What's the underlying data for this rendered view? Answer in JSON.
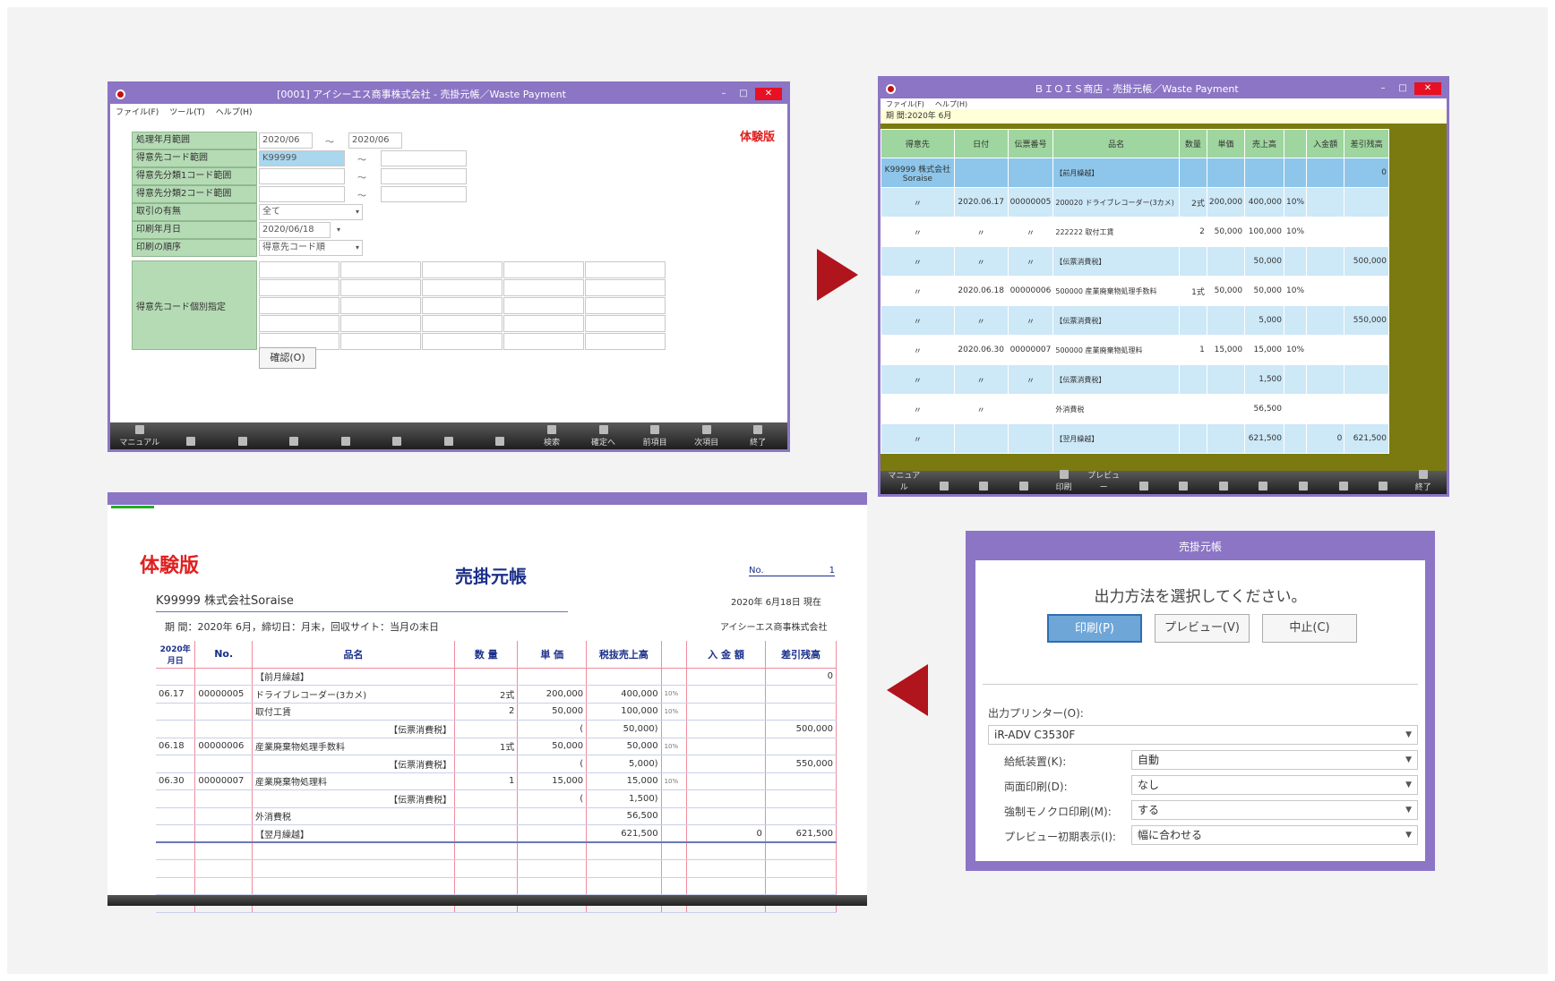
{
  "win1": {
    "title": "[0001] アイシーエス商事株式会社 - 売掛元帳／Waste Payment",
    "menu": [
      "ファイル(F)",
      "ツール(T)",
      "ヘルプ(H)"
    ],
    "trial": "体験版",
    "fields": [
      {
        "label": "処理年月範囲",
        "from": "2020/06",
        "to": "2020/06"
      },
      {
        "label": "得意先コード範囲",
        "from": "K99999",
        "to": ""
      },
      {
        "label": "得意先分類1コード範囲",
        "from": "",
        "to": ""
      },
      {
        "label": "得意先分類2コード範囲",
        "from": "",
        "to": ""
      }
    ],
    "tilde": "～",
    "torihiki_label": "取引の有無",
    "torihiki_value": "全て",
    "print_date_label": "印刷年月日",
    "print_date_value": "2020/06/18",
    "order_label": "印刷の順序",
    "order_value": "得意先コード順",
    "indiv_label": "得意先コード個別指定",
    "confirm": "確認(O)",
    "fkeys": [
      "マニュアル",
      "",
      "",
      "",
      "",
      "",
      "",
      "",
      "検索",
      "確定へ",
      "前項目",
      "次項目",
      "終了"
    ]
  },
  "win2": {
    "title": "ＢＩＯＩＳ商店 - 売掛元帳／Waste Payment",
    "menu": [
      "ファイル(F)",
      "ヘルプ(H)"
    ],
    "period": "期 間:2020年 6月",
    "headers": [
      "得意先",
      "日付",
      "伝票番号",
      "品名",
      "数量",
      "単価",
      "売上高",
      "",
      "入金額",
      "差引残高"
    ],
    "rows": [
      {
        "cls": "sel",
        "c": [
          "K99999 株式会社Soraise",
          "",
          "",
          "【前月繰越】",
          "",
          "",
          "",
          "",
          "",
          "0"
        ]
      },
      {
        "cls": "b",
        "c": [
          "〃",
          "2020.06.17",
          "00000005",
          "200020 ドライブレコーダー(3カメ)",
          "2式",
          "200,000",
          "400,000",
          "10%",
          "",
          ""
        ]
      },
      {
        "cls": "w",
        "c": [
          "〃",
          "〃",
          "〃",
          "222222 取付工賃",
          "2",
          "50,000",
          "100,000",
          "10%",
          "",
          ""
        ]
      },
      {
        "cls": "b",
        "c": [
          "〃",
          "〃",
          "〃",
          "【伝票消費税】",
          "",
          "",
          "50,000",
          "",
          "",
          "500,000"
        ]
      },
      {
        "cls": "w",
        "c": [
          "〃",
          "2020.06.18",
          "00000006",
          "500000 産業廃棄物処理手数料",
          "1式",
          "50,000",
          "50,000",
          "10%",
          "",
          ""
        ]
      },
      {
        "cls": "b",
        "c": [
          "〃",
          "〃",
          "〃",
          "【伝票消費税】",
          "",
          "",
          "5,000",
          "",
          "",
          "550,000"
        ]
      },
      {
        "cls": "w",
        "c": [
          "〃",
          "2020.06.30",
          "00000007",
          "500000 産業廃棄物処理料",
          "1",
          "15,000",
          "15,000",
          "10%",
          "",
          ""
        ]
      },
      {
        "cls": "b",
        "c": [
          "〃",
          "〃",
          "〃",
          "【伝票消費税】",
          "",
          "",
          "1,500",
          "",
          "",
          ""
        ]
      },
      {
        "cls": "w",
        "c": [
          "〃",
          "〃",
          "",
          "外消費税",
          "",
          "",
          "56,500",
          "",
          "",
          ""
        ]
      },
      {
        "cls": "b",
        "c": [
          "〃",
          "",
          "",
          "【翌月繰越】",
          "",
          "",
          "621,500",
          "",
          "0",
          "621,500"
        ]
      }
    ],
    "fkeys": [
      "マニュアル",
      "",
      "",
      "",
      "印刷",
      "プレビュー",
      "",
      "",
      "",
      "",
      "",
      "",
      "",
      "終了"
    ]
  },
  "preview": {
    "trial": "体験版",
    "title": "売掛元帳",
    "no_label": "No.",
    "no_value": "1",
    "customer": "K99999 株式会社Soraise",
    "date": "2020年 6月18日 現在",
    "conditions": "期 間：2020年 6月，締切日：月末，回収サイト：当月の末日",
    "company": "アイシーエス商事株式会社",
    "headers": [
      "2020年 月日",
      "No.",
      "品名",
      "数 量",
      "単 価",
      "税抜売上高",
      "",
      "入 金 額",
      "差引残高"
    ],
    "rows": [
      [
        "",
        "",
        "【前月繰越】",
        "",
        "",
        "",
        "",
        "",
        "0"
      ],
      [
        "06.17",
        "00000005",
        "ドライブレコーダー(3カメ)",
        "2式",
        "200,000",
        "400,000",
        "10%",
        "",
        ""
      ],
      [
        "",
        "",
        "取付工賃",
        "2",
        "50,000",
        "100,000",
        "10%",
        "",
        ""
      ],
      [
        "",
        "",
        "【伝票消費税】",
        "",
        "(",
        "50,000)",
        "",
        "",
        "500,000"
      ],
      [
        "06.18",
        "00000006",
        "産業廃棄物処理手数料",
        "1式",
        "50,000",
        "50,000",
        "10%",
        "",
        ""
      ],
      [
        "",
        "",
        "【伝票消費税】",
        "",
        "(",
        "5,000)",
        "",
        "",
        "550,000"
      ],
      [
        "06.30",
        "00000007",
        "産業廃棄物処理料",
        "1",
        "15,000",
        "15,000",
        "10%",
        "",
        ""
      ],
      [
        "",
        "",
        "【伝票消費税】",
        "",
        "(",
        "1,500)",
        "",
        "",
        ""
      ],
      [
        "",
        "",
        "外消費税",
        "",
        "",
        "56,500",
        "",
        "",
        ""
      ],
      [
        "",
        "",
        "【翌月繰越】",
        "",
        "",
        "621,500",
        "",
        "0",
        "621,500"
      ]
    ]
  },
  "dialog": {
    "title": "売掛元帳",
    "message": "出力方法を選択してください。",
    "buttons": [
      "印刷(P)",
      "プレビュー(V)",
      "中止(C)"
    ],
    "printer_label": "出力プリンター(O):",
    "printer_value": "iR-ADV C3530F",
    "options": [
      {
        "label": "給紙装置(K):",
        "value": "自動"
      },
      {
        "label": "両面印刷(D):",
        "value": "なし"
      },
      {
        "label": "強制モノクロ印刷(M):",
        "value": "する"
      },
      {
        "label": "プレビュー初期表示(I):",
        "value": "幅に合わせる"
      }
    ]
  }
}
